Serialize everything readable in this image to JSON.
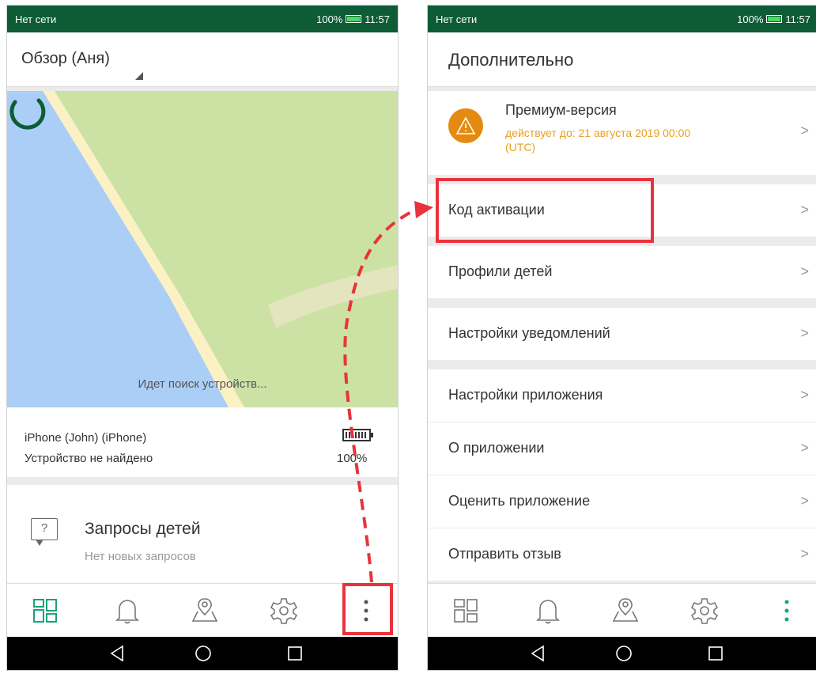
{
  "left_screen": {
    "status_left": "Нет сети",
    "status_right": "100%",
    "time": "11:57",
    "profile_label": "Обзор (Аня)",
    "map_status": "Идет поиск устройств...",
    "device": {
      "name": "iPhone (John) (iPhone)",
      "status": "Устройство не найдено",
      "battery": "100%"
    },
    "requests": {
      "title": "Запросы детей",
      "subtitle": "Нет новых запросов",
      "icon_char": "?"
    },
    "nav": [
      "overview-icon",
      "bell-icon",
      "map-pin-icon",
      "settings-icon",
      "more-icon"
    ]
  },
  "right_screen": {
    "status_left": "Нет сети",
    "status_right": "100%",
    "time": "11:57",
    "title": "Дополнительно",
    "premium": {
      "title": "Премиум-версия",
      "subtitle": "действует до: 21 августа 2019 00:00 (UTC)"
    },
    "menu": [
      {
        "label": "Код активации"
      },
      {
        "label": "Профили детей"
      },
      {
        "label": "Настройки уведомлений"
      },
      {
        "label": "Настройки приложения"
      },
      {
        "label": "О приложении"
      },
      {
        "label": "Оценить приложение"
      },
      {
        "label": "Отправить отзыв"
      }
    ],
    "nav": [
      "overview-icon",
      "bell-icon",
      "map-pin-icon",
      "settings-icon",
      "more-icon"
    ]
  },
  "colors": {
    "status_bar": "#0d5c35",
    "accent_green": "#1aa37a",
    "premium_orange": "#e48a10",
    "highlight_red": "#e8333c"
  }
}
